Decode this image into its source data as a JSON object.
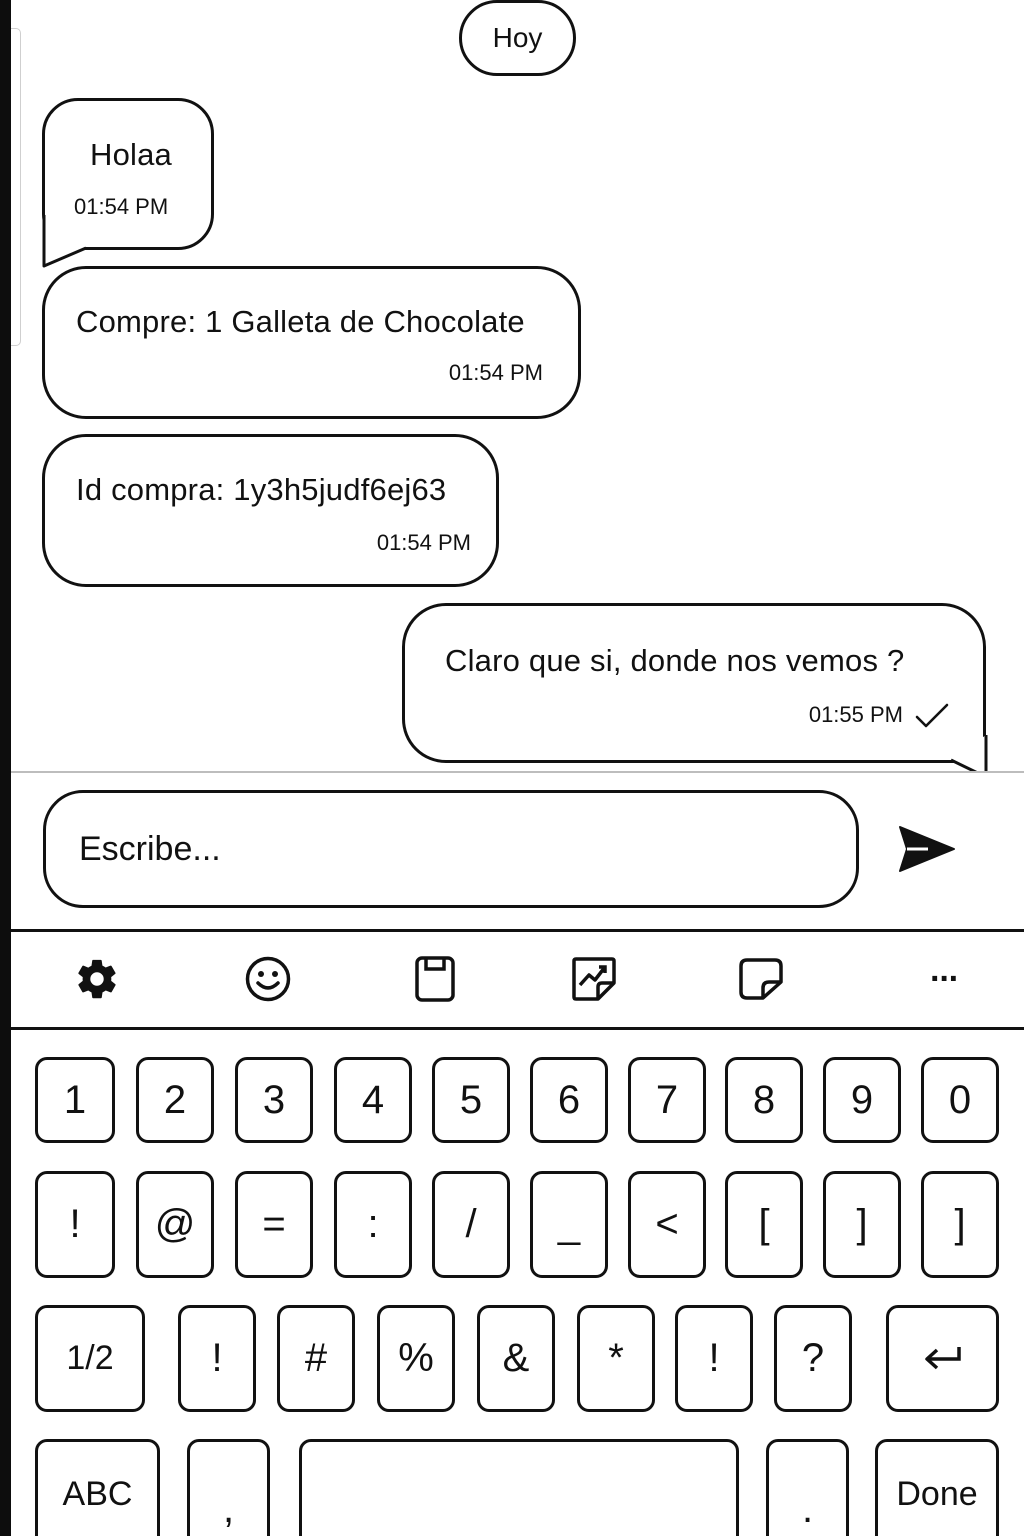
{
  "date_chip": "Hoy",
  "messages": [
    {
      "text": "Holaa",
      "time": "01:54 PM"
    },
    {
      "text": "Compre: 1 Galleta de Chocolate",
      "time": "01:54 PM"
    },
    {
      "text": "Id compra: 1y3h5judf6ej63",
      "time": "01:54 PM"
    },
    {
      "text": "Claro que si, donde nos vemos ?",
      "time": "01:55 PM"
    }
  ],
  "composer": {
    "placeholder": "Escribe..."
  },
  "keyboard": {
    "toolbar_icons": [
      "gear-icon",
      "emoji-icon",
      "clipboard-icon",
      "sticker-icon",
      "notes-icon",
      "more-icon"
    ],
    "more_label": "···",
    "row1": [
      "1",
      "2",
      "3",
      "4",
      "5",
      "6",
      "7",
      "8",
      "9",
      "0"
    ],
    "row2": [
      "!",
      "@",
      "=",
      ":",
      "/",
      "_",
      "<",
      "[",
      "]",
      "]"
    ],
    "row3": [
      "1/2",
      "!",
      "#",
      "%",
      "&",
      "*",
      "!",
      "?"
    ],
    "row4": {
      "abc": "ABC",
      "comma": ",",
      "period": ".",
      "done": "Done"
    }
  }
}
